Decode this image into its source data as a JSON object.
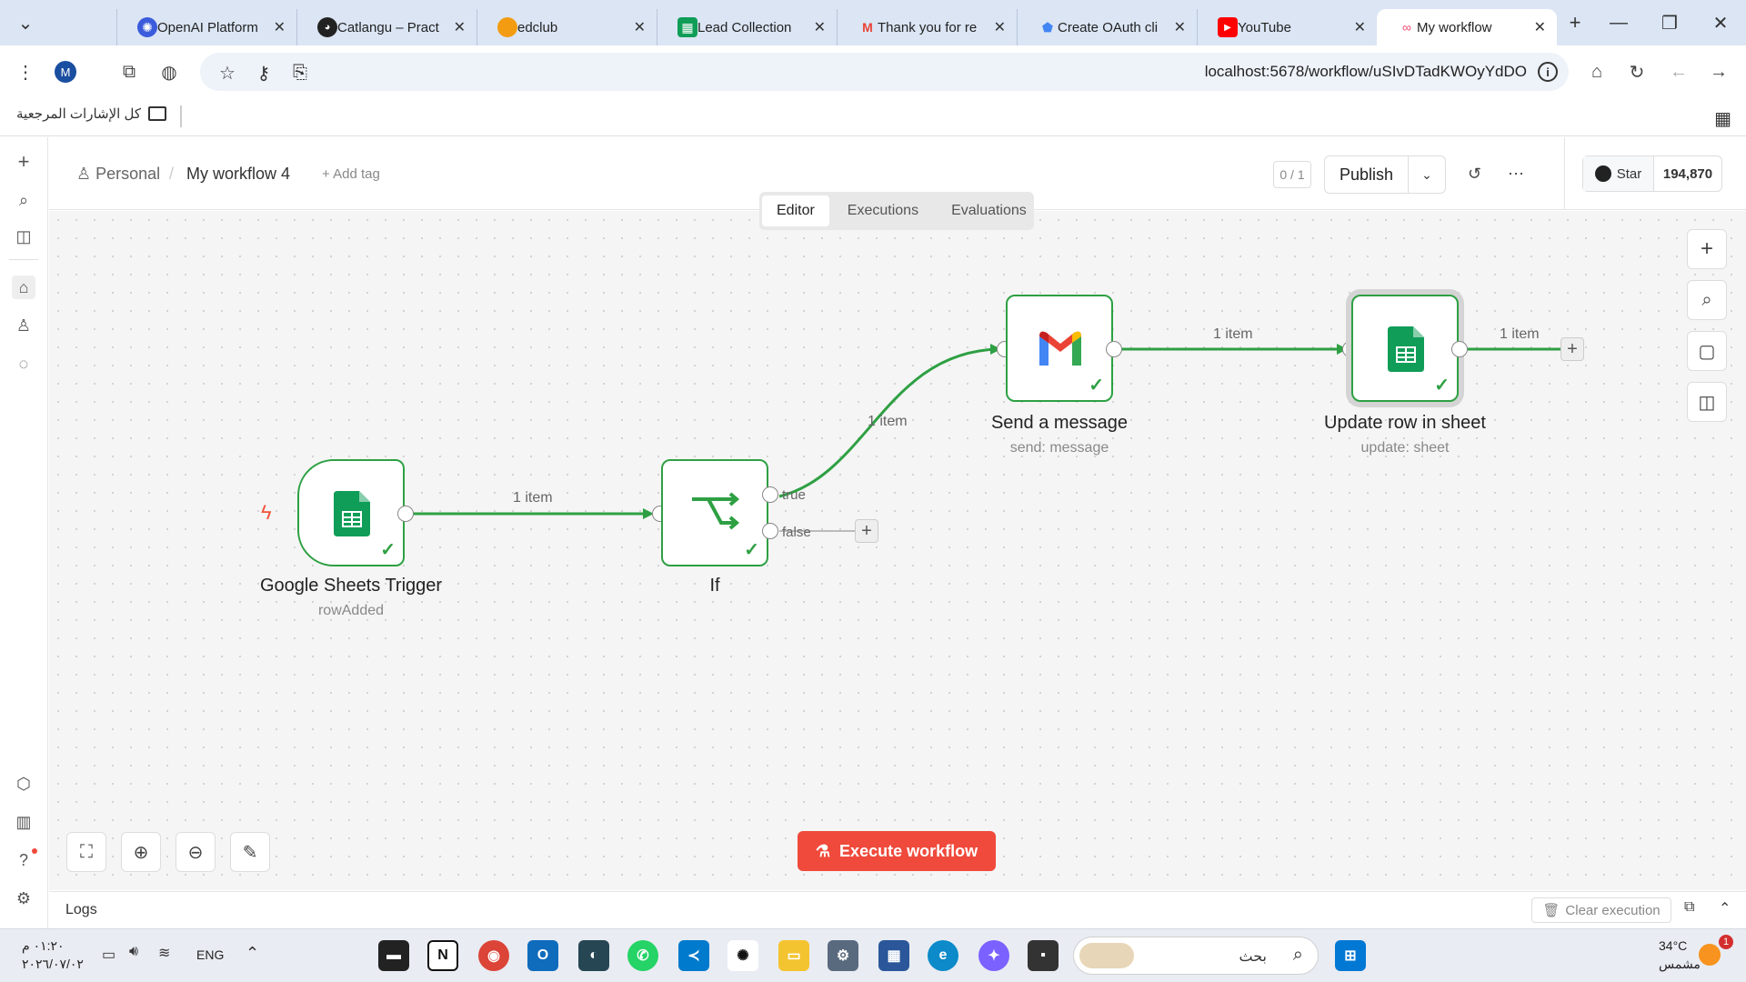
{
  "browser": {
    "tabs": [
      {
        "title": "My workflow",
        "favicon": "n8n-icon",
        "color": "#ea4b71",
        "active": true
      },
      {
        "title": "YouTube",
        "favicon": "youtube-icon",
        "color": "#ff0000"
      },
      {
        "title": "Create OAuth cli",
        "favicon": "shield-icon",
        "color": "#4285f4"
      },
      {
        "title": "Thank you for re",
        "favicon": "gmail-icon",
        "color": "#ea4335"
      },
      {
        "title": "Lead Collection",
        "favicon": "sheets-icon",
        "color": "#0f9d58"
      },
      {
        "title": "edclub",
        "favicon": "edclub-icon",
        "color": "#f39c12"
      },
      {
        "title": "Catlangu – Pract",
        "favicon": "cat-icon",
        "color": "#222222"
      },
      {
        "title": "OpenAI Platform",
        "favicon": "openai-icon",
        "color": "#3b5bdb"
      }
    ],
    "url": "localhost:5678/workflow/uSIvDTadKWOyYdDO",
    "profile_initial": "M",
    "bookmarks_label": "كل الإشارات المرجعية"
  },
  "header": {
    "breadcrumb_personal": "Personal",
    "separator": "/",
    "workflow_name": "My workflow 4",
    "add_tag": "+ Add tag",
    "counter": "0 / 1",
    "publish": "Publish",
    "github_star": "Star",
    "github_count": "194,870"
  },
  "view_tabs": [
    "Editor",
    "Executions",
    "Evaluations"
  ],
  "nodes": {
    "trigger": {
      "label": "Google Sheets Trigger",
      "sub": "rowAdded"
    },
    "if": {
      "label": "If",
      "true": "true",
      "false": "false"
    },
    "gmail": {
      "label": "Send a message",
      "sub": "send: message"
    },
    "update": {
      "label": "Update row in sheet",
      "sub": "update: sheet"
    }
  },
  "edges": {
    "e1": "1 item",
    "e2": "1 item",
    "e3": "1 item",
    "e4": "1 item"
  },
  "execute_button": "Execute workflow",
  "logs": {
    "label": "Logs",
    "clear": "Clear execution"
  },
  "taskbar": {
    "time": "٠١:٢٠ م",
    "date": "٢٠٢٦/٠٧/٠٢",
    "lang": "ENG",
    "search": "بحث",
    "weather_temp": "34°C",
    "weather_desc": "مشمس",
    "notif_count": "1"
  },
  "colors": {
    "success": "#2ea043",
    "execute": "#ef4a3b",
    "sheets": "#0f9d58"
  }
}
